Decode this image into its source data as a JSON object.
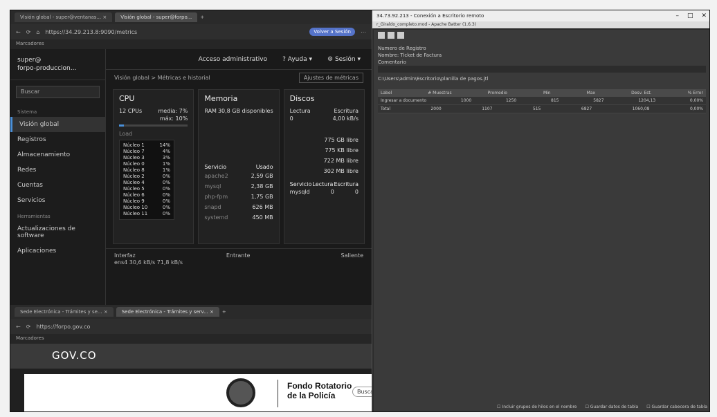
{
  "browser1": {
    "tabs": [
      "Visión global - super@ventanas... ×",
      "Visión global - super@forpo..."
    ],
    "url": "https://34.29.213.8:9090/metrics",
    "profile": "Volver a Sesión",
    "bookmarks": "Marcadores"
  },
  "cockpit": {
    "host_user": "super@",
    "host_name": "forpo-produccion...",
    "search_placeholder": "Buscar",
    "sections": {
      "system": "Sistema",
      "tools": "Herramientas"
    },
    "nav": [
      "Visión global",
      "Registros",
      "Almacenamiento",
      "Redes",
      "Cuentas",
      "Servicios",
      "Actualizaciones de software",
      "Aplicaciones"
    ],
    "topbar": {
      "admin": "Acceso administrativo",
      "help": "Ayuda",
      "session": "Sesión"
    },
    "breadcrumb": {
      "root": "Visión global",
      "current": "Métricas e historial",
      "metrics_settings": "Ajustes de métricas"
    },
    "cpu": {
      "title": "CPU",
      "cpus": "12 CPUs",
      "media": "media: 7%",
      "max": "máx: 10%",
      "load_label": "Load",
      "usage_fraction": 0.07,
      "cores": [
        {
          "name": "Núcleo 1",
          "pct": "14%"
        },
        {
          "name": "Núcleo 7",
          "pct": "4%"
        },
        {
          "name": "Núcleo 3",
          "pct": "3%"
        },
        {
          "name": "Núcleo 0",
          "pct": "1%"
        },
        {
          "name": "Núcleo 8",
          "pct": "1%"
        },
        {
          "name": "Núcleo 2",
          "pct": "0%"
        },
        {
          "name": "Núcleo 4",
          "pct": "0%"
        },
        {
          "name": "Núcleo 5",
          "pct": "0%"
        },
        {
          "name": "Núcleo 6",
          "pct": "0%"
        },
        {
          "name": "Núcleo 9",
          "pct": "0%"
        },
        {
          "name": "Núcleo 10",
          "pct": "0%"
        },
        {
          "name": "Núcleo 11",
          "pct": "0%"
        }
      ]
    },
    "memory": {
      "title": "Memoria",
      "ram": "RAM",
      "available": "30,8 GB disponibles",
      "service_header": "Servicio",
      "used_header": "Usado",
      "services": [
        {
          "name": "apache2",
          "used": "2,59 GB"
        },
        {
          "name": "mysql",
          "used": "2,38 GB"
        },
        {
          "name": "php-fpm",
          "used": "1,75 GB"
        },
        {
          "name": "snapd",
          "used": "626 MB"
        },
        {
          "name": "systemd",
          "used": "450 MB"
        }
      ]
    },
    "disks": {
      "title": "Discos",
      "read": "Lectura",
      "write": "Escritura",
      "read_val": "0",
      "write_val": "4,00 kB/s",
      "free": [
        "775 GB libre",
        "775 KB libre",
        "722 MB libre",
        "302 MB libre"
      ],
      "svc_header": "Servicio",
      "svc_read": "Lectura",
      "svc_write": "Escritura",
      "svc_row": {
        "name": "mysqld",
        "read": "0",
        "write": "0"
      }
    },
    "iface": {
      "label": "Interfaz",
      "in": "Entrante",
      "out": "Saliente",
      "row": "ens4  30,6 kB/s  71,8 kB/s"
    }
  },
  "browser2": {
    "tabs": [
      "Sede Electrónica - Trámites y se... ×",
      "Sede Electrónica - Trámites y serv... ×"
    ],
    "url": "https://forpo.gov.co",
    "bookmarks": "Marcadores",
    "gov_logo": "GOV.CO",
    "org_line1": "Fondo Rotatorio",
    "org_line2": "de la Policía",
    "search_btn": "Buscar"
  },
  "remote": {
    "title": "34.73.92.213 - Conexión a Escritorio remoto",
    "subtitle": "r_Giraldo_completo.mod - Apache Batter (1.6.3)",
    "panel_title": "Numero de Registro",
    "name_label": "Nombre",
    "name_value": "Ticket de Factura",
    "comment_label": "Comentario",
    "path": "C:\\Users\\admin\\Escritorio\\planilla de pagos.jtl",
    "grid_headers": [
      "Label",
      "# Muestras",
      "Promedio",
      "Min",
      "Max",
      "Desv. Est.",
      "% Error"
    ],
    "grid_rows": [
      [
        "Ingresar a documento",
        "1000",
        "1250",
        "815",
        "5827",
        "1204,13",
        "0,00%"
      ],
      [
        "Total",
        "2000",
        "1107",
        "515",
        "6827",
        "1060,08",
        "0,00%"
      ]
    ],
    "status": [
      "Incluir grupos de hilos en el nombre",
      "Guardar datos de tabla",
      "Guardar cabecera de tabla"
    ]
  }
}
